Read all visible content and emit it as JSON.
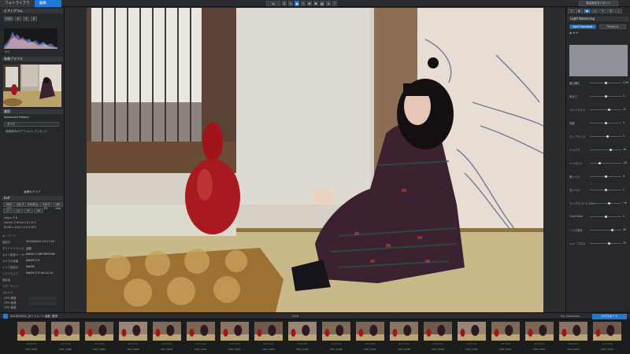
{
  "top": {
    "tab_library": "フォトライブラリ",
    "tab_edit": "編集",
    "export_label": "書出設定をリセット",
    "tool_icons": [
      "compare-icon",
      "crop-icon",
      "rotate-icon",
      "brush-icon",
      "picker-icon",
      "repair-icon",
      "grid-icon",
      "help-icon"
    ]
  },
  "left": {
    "histogram_header": "ヒストグラム",
    "nav_header": "画像ブラウズ",
    "history_header": "履歴",
    "history_item": "Advanced History",
    "history_btn": "すべて",
    "history_note": "適用済みのデフォルトプリセット",
    "presets_header": "画像をクリア",
    "exif_header": "Exif",
    "exif_badges": [
      "ISO 400",
      "f/1.7",
      "1/100 s",
      "+0.3 EV",
      "85 mm"
    ],
    "camera_model": "Nikon Z 6",
    "lens": "Nikkor Z 85mm f/1.8 S",
    "dims": "6048 x 4024 (24.3 MP)",
    "meta": [
      {
        "k": "キーワード",
        "v": ""
      },
      {
        "k": "撮影日",
        "v": "2019/03/22 15:17:40"
      },
      {
        "k": "ホワイトバランス",
        "v": "自動"
      },
      {
        "k": "カメラ製造メーカー",
        "v": "NIKON CORPORATION"
      },
      {
        "k": "カメラの型番",
        "v": "NIKON Z 6"
      },
      {
        "k": "レンズ製造元",
        "v": "NIKON"
      },
      {
        "k": "ソフトウェア",
        "v": "NIKON Z 6 Ver.02.10"
      },
      {
        "k": "撮影者",
        "v": ""
      },
      {
        "k": "コピーライト",
        "v": ""
      },
      {
        "k": "コメント",
        "v": ""
      }
    ],
    "gps": [
      "GPS 緯度",
      "GPS 経度",
      "GPS 高度"
    ]
  },
  "right": {
    "panel_title": "Light Balancing",
    "preset_a": "DxO Standard",
    "preset_b": "Preset A",
    "sliders": [
      {
        "label": "露出補正",
        "value": "0.00",
        "pos": 0.5
      },
      {
        "label": "明るさ",
        "value": "0",
        "pos": 0.5
      },
      {
        "label": "コントラスト",
        "value": "12",
        "pos": 0.62
      },
      {
        "label": "彩度",
        "value": "0",
        "pos": 0.5
      },
      {
        "label": "ヴィブランス",
        "value": "5",
        "pos": 0.55
      },
      {
        "label": "シャドウ",
        "value": "18",
        "pos": 0.66
      },
      {
        "label": "ハイライト",
        "value": "-20",
        "pos": 0.32
      },
      {
        "label": "黒レベル",
        "value": "0",
        "pos": 0.5
      },
      {
        "label": "白レベル",
        "value": "0",
        "pos": 0.5
      },
      {
        "label": "マイクロコントラスト",
        "value": "+8",
        "pos": 0.6
      },
      {
        "label": "ClearView",
        "value": "0",
        "pos": 0.5
      },
      {
        "label": "ノイズ除去",
        "value": "40",
        "pos": 0.7
      },
      {
        "label": "シャープネス",
        "value": "25",
        "pos": 0.6
      }
    ]
  },
  "film": {
    "path": "2019/03/22_ポートレート撮影_着物",
    "count": "1200",
    "collection": "My Collection",
    "export_btn": "エクスポート",
    "thumbs": [
      "DSC_0487",
      "DSC_0488",
      "DSC_0489",
      "DSC_0490",
      "DSC_0491",
      "DSC_0492",
      "DSC_0493",
      "DSC_0494",
      "DSC_0495",
      "DSC_0496",
      "DSC_0497",
      "DSC_0498",
      "DSC_0499",
      "DSC_0500",
      "DSC_0501",
      "DSC_0502",
      "DSC_0503",
      "DSC_0504"
    ]
  }
}
